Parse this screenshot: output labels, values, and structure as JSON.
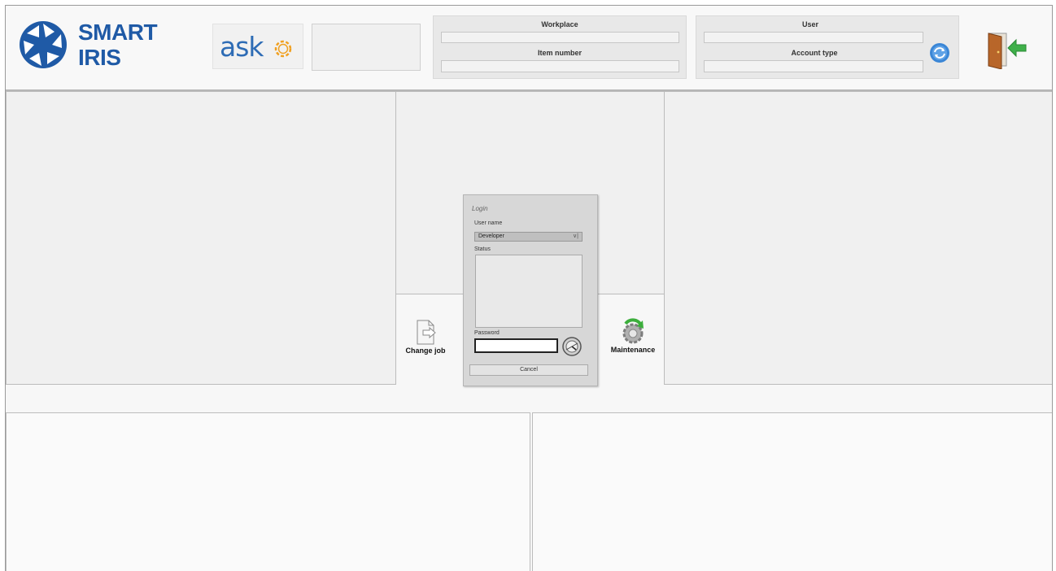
{
  "brand": {
    "line1": "SMART",
    "line2": "IRIS",
    "logo_icon": "aperture-icon",
    "color": "#1f5aa6"
  },
  "ask": {
    "text": "ask",
    "icon": "gear-icon"
  },
  "workplace_panel": {
    "workplace_label": "Workplace",
    "workplace_value": "",
    "item_number_label": "Item number",
    "item_number_value": ""
  },
  "user_panel": {
    "user_label": "User",
    "user_value": "",
    "account_type_label": "Account type",
    "account_type_value": "",
    "refresh_icon": "refresh-icon"
  },
  "exit": {
    "icon": "exit-door-icon"
  },
  "tools": {
    "change_job_label": "Change job",
    "change_job_icon": "document-edit-icon",
    "maintenance_label": "Maintenance",
    "maintenance_icon": "gear-refresh-icon"
  },
  "login": {
    "title": "Login",
    "user_name_label": "User name",
    "user_name_value": "Developer",
    "status_label": "Status",
    "password_label": "Password",
    "password_value": "",
    "key_icon": "gauge-icon",
    "cancel_label": "Cancel"
  }
}
